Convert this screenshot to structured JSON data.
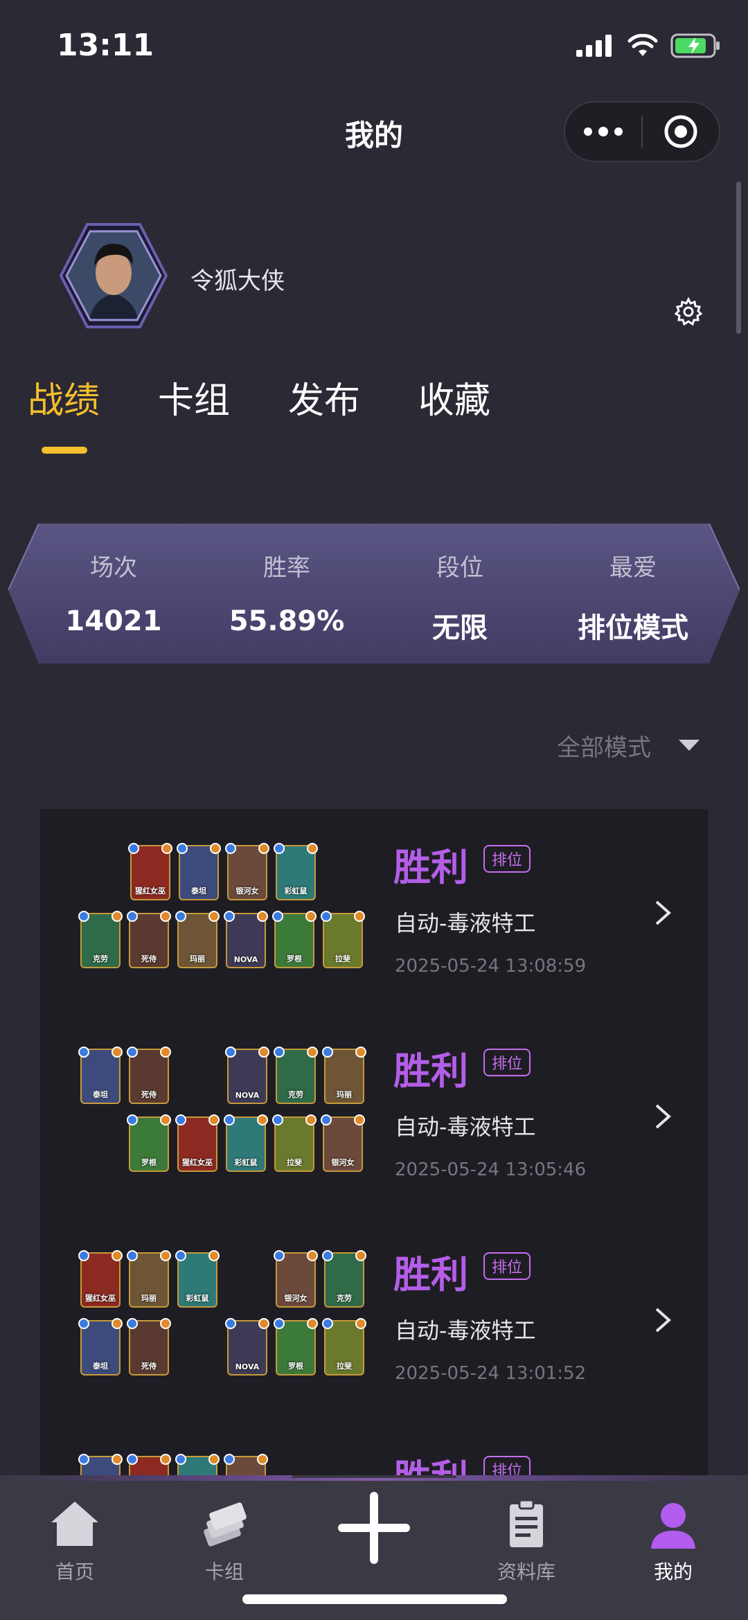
{
  "status_bar": {
    "time": "13:11"
  },
  "nav": {
    "title": "我的",
    "more_icon": "ellipsis-icon",
    "close_icon": "target-icon"
  },
  "profile": {
    "username": "令狐大侠",
    "settings_icon": "gear-icon"
  },
  "tabs": [
    {
      "label": "战绩",
      "active": true
    },
    {
      "label": "卡组",
      "active": false
    },
    {
      "label": "发布",
      "active": false
    },
    {
      "label": "收藏",
      "active": false
    }
  ],
  "stats": [
    {
      "label": "场次",
      "value": "14021"
    },
    {
      "label": "胜率",
      "value": "55.89%"
    },
    {
      "label": "段位",
      "value": "无限"
    },
    {
      "label": "最爱",
      "value": "排位模式"
    }
  ],
  "filter": {
    "label": "全部模式"
  },
  "records": [
    {
      "result": "胜利",
      "badge": "排位",
      "deck": "自动-毒液特工",
      "time": "2025-05-24 13:08:59"
    },
    {
      "result": "胜利",
      "badge": "排位",
      "deck": "自动-毒液特工",
      "time": "2025-05-24 13:05:46"
    },
    {
      "result": "胜利",
      "badge": "排位",
      "deck": "自动-毒液特工",
      "time": "2025-05-24 13:01:52"
    },
    {
      "result": "胜利",
      "badge": "排位",
      "deck": "",
      "time": ""
    }
  ],
  "card_names": {
    "c1": "猩红女巫",
    "c2": "泰坦",
    "c3": "银河女",
    "c4": "彩虹鼠",
    "c5": "克劳",
    "c6": "死侍",
    "c7": "玛丽",
    "c8": "NOVA",
    "c9": "罗根",
    "c10": "拉斐"
  },
  "bottom_nav": [
    {
      "label": "首页",
      "icon": "home-icon",
      "active": false
    },
    {
      "label": "卡组",
      "icon": "cards-icon",
      "active": false
    },
    {
      "label": "资料库",
      "icon": "clipboard-icon",
      "active": false
    },
    {
      "label": "我的",
      "icon": "user-icon",
      "active": true
    }
  ],
  "colors": {
    "accent": "#f5bf2d",
    "victory": "#b45ee8",
    "background": "#2b2934",
    "panel": "#1e1d23"
  }
}
